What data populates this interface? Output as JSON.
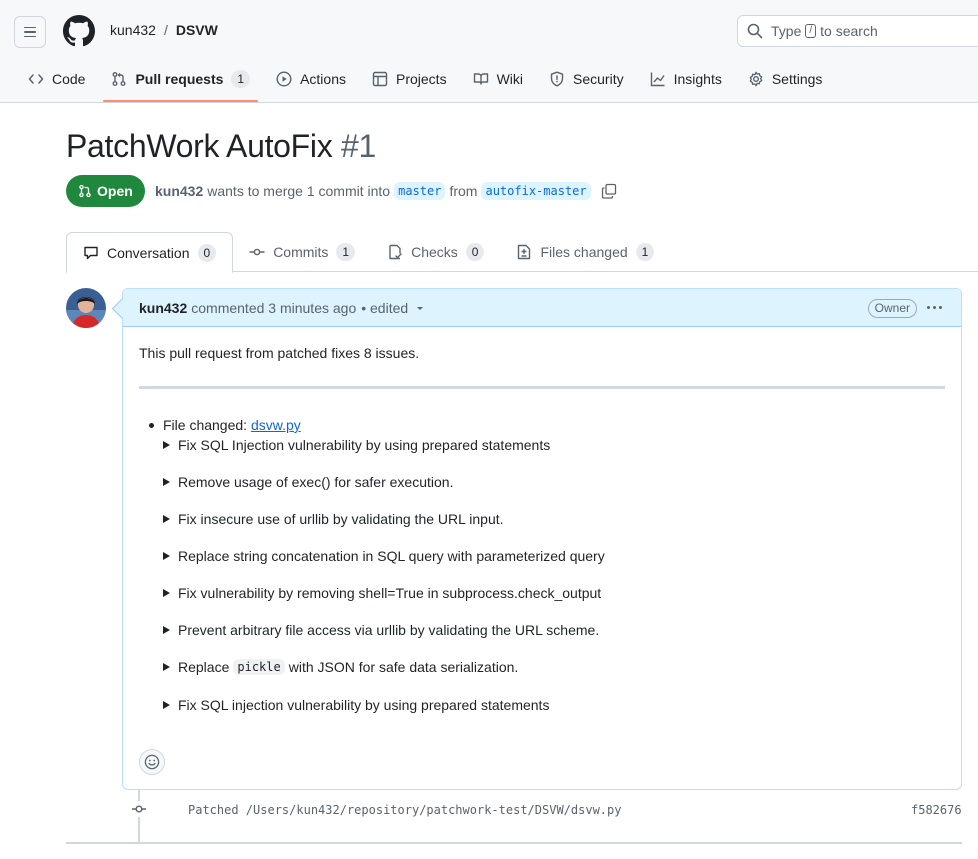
{
  "header": {
    "owner": "kun432",
    "separator": "/",
    "repo": "DSVW",
    "search_prefix": "Type",
    "search_key": "/",
    "search_suffix": "to search"
  },
  "repo_tabs": [
    {
      "label": "Code",
      "icon": "code-icon"
    },
    {
      "label": "Pull requests",
      "icon": "pull-request-icon",
      "count": "1"
    },
    {
      "label": "Actions",
      "icon": "play-icon"
    },
    {
      "label": "Projects",
      "icon": "table-icon"
    },
    {
      "label": "Wiki",
      "icon": "book-icon"
    },
    {
      "label": "Security",
      "icon": "shield-icon"
    },
    {
      "label": "Insights",
      "icon": "graph-icon"
    },
    {
      "label": "Settings",
      "icon": "gear-icon"
    }
  ],
  "pr": {
    "title": "PatchWork AutoFix",
    "number": "#1",
    "status": "Open",
    "author": "kun432",
    "merge_text": "wants to merge 1 commit into",
    "base_branch": "master",
    "from_text": "from",
    "head_branch": "autofix-master"
  },
  "pr_tabs": [
    {
      "label": "Conversation",
      "count": "0",
      "icon": "comment-icon"
    },
    {
      "label": "Commits",
      "count": "1",
      "icon": "commit-icon"
    },
    {
      "label": "Checks",
      "count": "0",
      "icon": "checklist-icon"
    },
    {
      "label": "Files changed",
      "count": "1",
      "icon": "file-diff-icon"
    }
  ],
  "comment": {
    "author": "kun432",
    "meta": "commented 3 minutes ago",
    "edited": "• edited",
    "role": "Owner",
    "intro": "This pull request from patched fixes 8 issues.",
    "file_label": "File changed:",
    "file_link": "dsvw.py",
    "items": [
      "Fix SQL Injection vulnerability by using prepared statements",
      "Remove usage of exec() for safer execution.",
      "Fix insecure use of urllib by validating the URL input.",
      "Replace string concatenation in SQL query with parameterized query",
      "Fix vulnerability by removing shell=True in subprocess.check_output",
      "Prevent arbitrary file access via urllib by validating the URL scheme.",
      "Replace",
      "Fix SQL injection vulnerability by using prepared statements"
    ],
    "item7_code": "pickle",
    "item7_rest": "with JSON for safe data serialization."
  },
  "commit": {
    "message": "Patched /Users/kun432/repository/patchwork-test/DSVW/dsvw.py",
    "sha": "f582676"
  },
  "colors": {
    "open_green": "#1f883d",
    "link_blue": "#0969da",
    "comment_header": "#ddf4ff",
    "active_tab_underline": "#fd8c73"
  }
}
